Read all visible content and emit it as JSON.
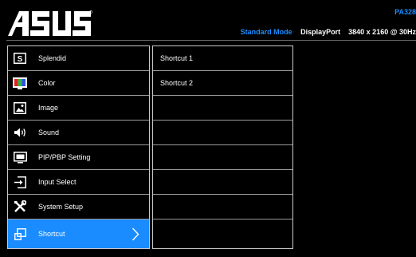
{
  "header": {
    "brand": "ASUS",
    "model": "PA328",
    "mode": "Standard Mode",
    "input": "DisplayPort",
    "resolution": "3840 x 2160 @ 30Hz"
  },
  "menu": {
    "items": [
      {
        "label": "Splendid",
        "icon": "splendid-s-icon"
      },
      {
        "label": "Color",
        "icon": "color-bars-icon"
      },
      {
        "label": "Image",
        "icon": "image-icon"
      },
      {
        "label": "Sound",
        "icon": "speaker-icon"
      },
      {
        "label": "PIP/PBP Setting",
        "icon": "pip-icon"
      },
      {
        "label": "Input Select",
        "icon": "input-icon"
      },
      {
        "label": "System Setup",
        "icon": "tools-icon"
      },
      {
        "label": "Shortcut",
        "icon": "shortcut-icon",
        "selected": true
      }
    ]
  },
  "submenu": {
    "items": [
      {
        "label": "Shortcut 1"
      },
      {
        "label": "Shortcut 2"
      },
      {
        "label": ""
      },
      {
        "label": ""
      },
      {
        "label": ""
      },
      {
        "label": ""
      },
      {
        "label": ""
      },
      {
        "label": ""
      }
    ]
  },
  "colors": {
    "accent": "#1a8cff",
    "background": "#000000",
    "border": "#c9c9c9"
  }
}
